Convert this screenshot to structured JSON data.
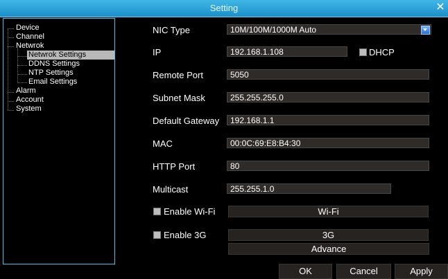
{
  "window": {
    "title": "Setting",
    "close_glyph": "✕"
  },
  "tree": {
    "items": [
      {
        "label": "Device"
      },
      {
        "label": "Channel"
      },
      {
        "label": "Netwrok"
      },
      {
        "label": "Netwrok Settings",
        "selected": true
      },
      {
        "label": "DDNS Settings"
      },
      {
        "label": "NTP Settings"
      },
      {
        "label": "Email Settings"
      },
      {
        "label": "Alarm"
      },
      {
        "label": "Account"
      },
      {
        "label": "System"
      }
    ]
  },
  "form": {
    "nic_type": {
      "label": "NIC Type",
      "value": "10M/100M/1000M Auto"
    },
    "ip": {
      "label": "IP",
      "value": "192.168.1.108"
    },
    "dhcp": {
      "label": "DHCP",
      "checked": false
    },
    "remote_port": {
      "label": "Remote Port",
      "value": "5050"
    },
    "subnet_mask": {
      "label": "Subnet Mask",
      "value": "255.255.255.0"
    },
    "default_gateway": {
      "label": "Default Gateway",
      "value": "192.168.1.1"
    },
    "mac": {
      "label": "MAC",
      "value": "00:0C:69:E8:B4:30"
    },
    "http_port": {
      "label": "HTTP Port",
      "value": "80"
    },
    "multicast": {
      "label": "Multicast",
      "value": "255.255.1.0"
    },
    "enable_wifi": {
      "label": "Enable Wi-Fi",
      "checked": false,
      "button_label": "Wi-Fi"
    },
    "enable_3g": {
      "label": "Enable 3G",
      "checked": false,
      "button_label": "3G"
    },
    "advance_label": "Advance"
  },
  "buttons": {
    "ok": "OK",
    "cancel": "Cancel",
    "apply": "Apply"
  }
}
